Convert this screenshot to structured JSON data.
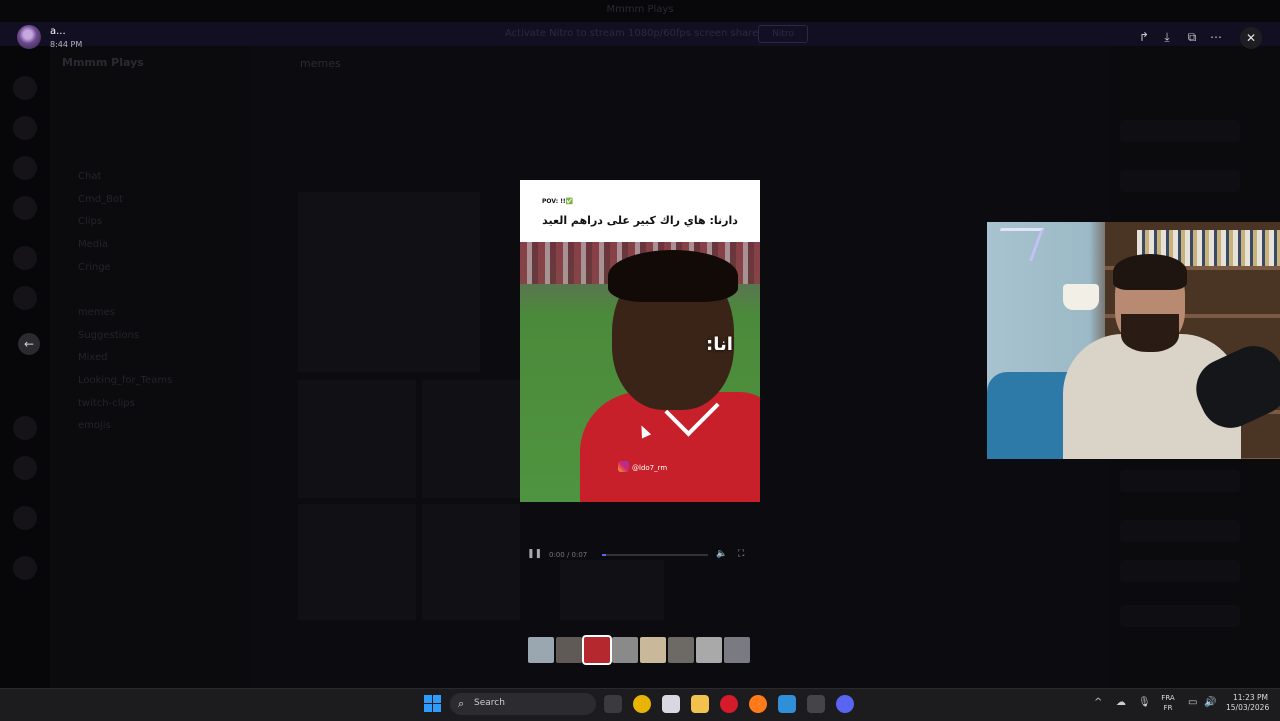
{
  "window": {
    "title": "Mmmm Plays"
  },
  "banner": {
    "text": "Activate Nitro to stream 1080p/60fps screen share",
    "button": "Nitro"
  },
  "server": {
    "name": "Mmmm Plays"
  },
  "channel": {
    "name": "memes"
  },
  "channels": [
    "Chat",
    "Cmd_Bot",
    "Clips",
    "Media",
    "Cringe",
    "",
    "memes",
    "Suggestions",
    "Mixed",
    "Looking_for_Teams",
    "twitch-clips",
    "emojis"
  ],
  "viewer": {
    "user_name": "a...",
    "timestamp": "8:44 PM",
    "actions": [
      "forward-icon",
      "download-icon",
      "open-external-icon",
      "more-icon"
    ],
    "close_label": "✕",
    "back_label": "←"
  },
  "video": {
    "pov_label": "POV: !!✅",
    "caption": "دارنا: هاي راك كبير على دراهم العيد",
    "overlay_text": "انا:",
    "ig_handle": "@ldo7_rm",
    "time": "0:00 / 0:07",
    "progress": 0.04
  },
  "thumbnails": [
    {
      "color": "#9aa7b0",
      "active": false
    },
    {
      "color": "#5f5a56",
      "active": false
    },
    {
      "color": "#b5282e",
      "active": true
    },
    {
      "color": "#8a8a8a",
      "active": false
    },
    {
      "color": "#c9b89a",
      "active": false
    },
    {
      "color": "#6d6a66",
      "active": false
    },
    {
      "color": "#a9a9a9",
      "active": false
    },
    {
      "color": "#7a7a82",
      "active": false
    }
  ],
  "taskbar": {
    "search_label": "Search",
    "lang_top": "FRA",
    "lang_bottom": "FR",
    "time": "11:23 PM",
    "date": "15/03/2026",
    "apps": [
      {
        "name": "file-explorer-icon",
        "color": "#3b3b3f"
      },
      {
        "name": "chrome-icon",
        "color": "#e8b400"
      },
      {
        "name": "app-icon",
        "color": "#d8d8e2"
      },
      {
        "name": "folder-icon",
        "color": "#f2c14e"
      },
      {
        "name": "opera-icon",
        "color": "#d31b2c"
      },
      {
        "name": "firefox-icon",
        "color": "#ff7a1a"
      },
      {
        "name": "app2-icon",
        "color": "#2f8fd8"
      },
      {
        "name": "settings-app-icon",
        "color": "#444449"
      },
      {
        "name": "discord-icon",
        "color": "#5865f2"
      }
    ]
  }
}
